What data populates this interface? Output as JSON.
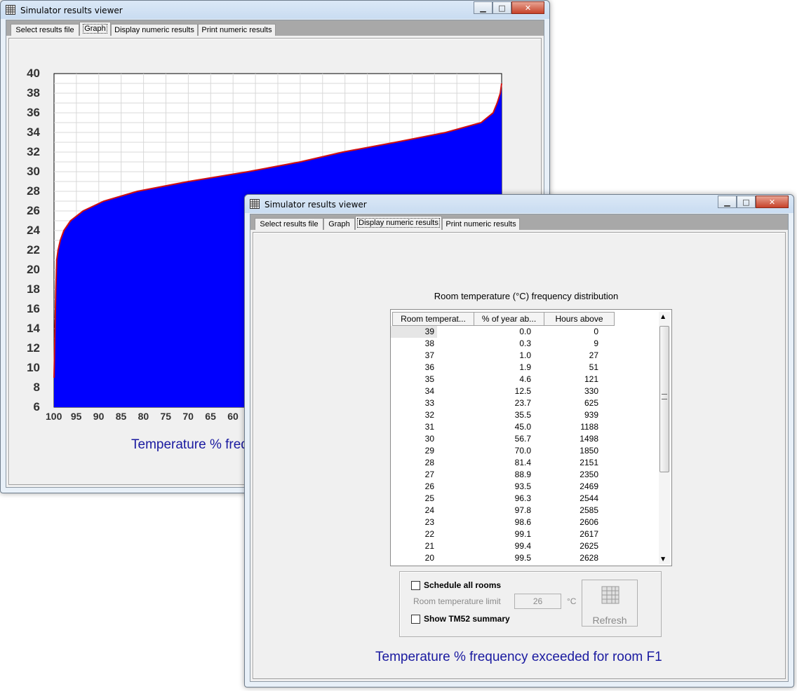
{
  "back_window": {
    "title": "Simulator results viewer",
    "tabs": [
      "Select results file",
      "Graph",
      "Display numeric results",
      "Print numeric results"
    ],
    "active_tab": "Graph",
    "caption": "Temperature % freq"
  },
  "chart_data": {
    "type": "area",
    "title": "",
    "xlabel": "",
    "ylabel": "",
    "x_ticks": [
      "100",
      "95",
      "90",
      "85",
      "80",
      "75",
      "70",
      "65",
      "60"
    ],
    "y_ticks": [
      "40",
      "38",
      "36",
      "34",
      "32",
      "30",
      "28",
      "26",
      "24",
      "22",
      "20",
      "18",
      "16",
      "14",
      "12",
      "10",
      "8",
      "6"
    ],
    "xlim": [
      100,
      0
    ],
    "ylim": [
      6,
      40
    ],
    "grid": true,
    "fill_color": "#0000ff",
    "line_color": "#d01010",
    "series": [
      {
        "x": [
          100,
          99.6,
          99.4,
          99.1,
          98.6,
          97.8,
          96.3,
          93.5,
          88.9,
          81.4,
          70.0,
          56.7,
          45.0,
          35.5,
          23.7,
          12.5,
          4.6,
          1.9,
          1.0,
          0.3,
          0.0
        ],
        "y": [
          9,
          18,
          21,
          22,
          23,
          24,
          25,
          26,
          27,
          28,
          29,
          30,
          31,
          32,
          33,
          34,
          35,
          36,
          37,
          38,
          39
        ]
      }
    ]
  },
  "front_window": {
    "title": "Simulator results viewer",
    "tabs": [
      "Select results file",
      "Graph",
      "Display numeric results",
      "Print numeric results"
    ],
    "active_tab": "Display numeric results",
    "table_title": "Room temperature (°C) frequency distribution",
    "columns": [
      "Room temperat...",
      "% of year ab...",
      "Hours above"
    ],
    "rows": [
      [
        "39",
        "0.0",
        "0"
      ],
      [
        "38",
        "0.3",
        "9"
      ],
      [
        "37",
        "1.0",
        "27"
      ],
      [
        "36",
        "1.9",
        "51"
      ],
      [
        "35",
        "4.6",
        "121"
      ],
      [
        "34",
        "12.5",
        "330"
      ],
      [
        "33",
        "23.7",
        "625"
      ],
      [
        "32",
        "35.5",
        "939"
      ],
      [
        "31",
        "45.0",
        "1188"
      ],
      [
        "30",
        "56.7",
        "1498"
      ],
      [
        "29",
        "70.0",
        "1850"
      ],
      [
        "28",
        "81.4",
        "2151"
      ],
      [
        "27",
        "88.9",
        "2350"
      ],
      [
        "26",
        "93.5",
        "2469"
      ],
      [
        "25",
        "96.3",
        "2544"
      ],
      [
        "24",
        "97.8",
        "2585"
      ],
      [
        "23",
        "98.6",
        "2606"
      ],
      [
        "22",
        "99.1",
        "2617"
      ],
      [
        "21",
        "99.4",
        "2625"
      ],
      [
        "20",
        "99.5",
        "2628"
      ]
    ],
    "options": {
      "schedule_all_rooms": "Schedule all rooms",
      "room_temp_limit_label": "Room temperature limit",
      "room_temp_limit_value": "26",
      "unit": "°C",
      "show_tm52": "Show TM52 summary",
      "refresh": "Refresh"
    },
    "caption": "Temperature % frequency exceeded for room F1"
  }
}
